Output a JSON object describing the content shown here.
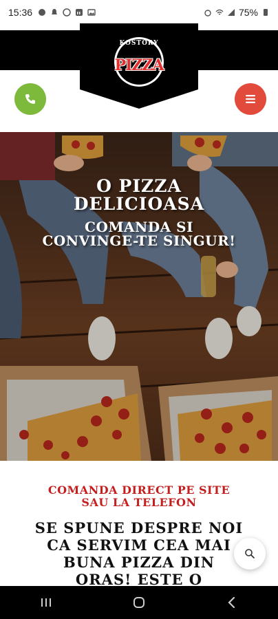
{
  "status_bar": {
    "time": "15:36",
    "battery": "75%"
  },
  "header": {
    "logo_top": "KOSTORY",
    "logo_main": "PIZZA"
  },
  "hero": {
    "line1": "O PIZZA",
    "line2": "DELICIOASA",
    "line3": "COMANDA SI",
    "line4": "CONVINGE-TE SINGUR!"
  },
  "content": {
    "subhead1": "COMANDA DIRECT PE SITE",
    "subhead2": "SAU LA TELEFON",
    "body1": "SE SPUNE DESPRE NOI",
    "body2": "CA SERVIM CEA MAI",
    "body3": "BUNA PIZZA DIN",
    "body4": "ORAS! ESTE O"
  },
  "colors": {
    "phone_button": "#7db93a",
    "menu_button": "#e24a3c",
    "accent_red": "#c41e1e",
    "header_black": "#000000"
  },
  "icons": {
    "phone": "phone-icon",
    "menu": "hamburger-menu-icon",
    "search": "search-icon",
    "nav_recents": "recents-icon",
    "nav_home": "home-icon",
    "nav_back": "back-icon"
  }
}
